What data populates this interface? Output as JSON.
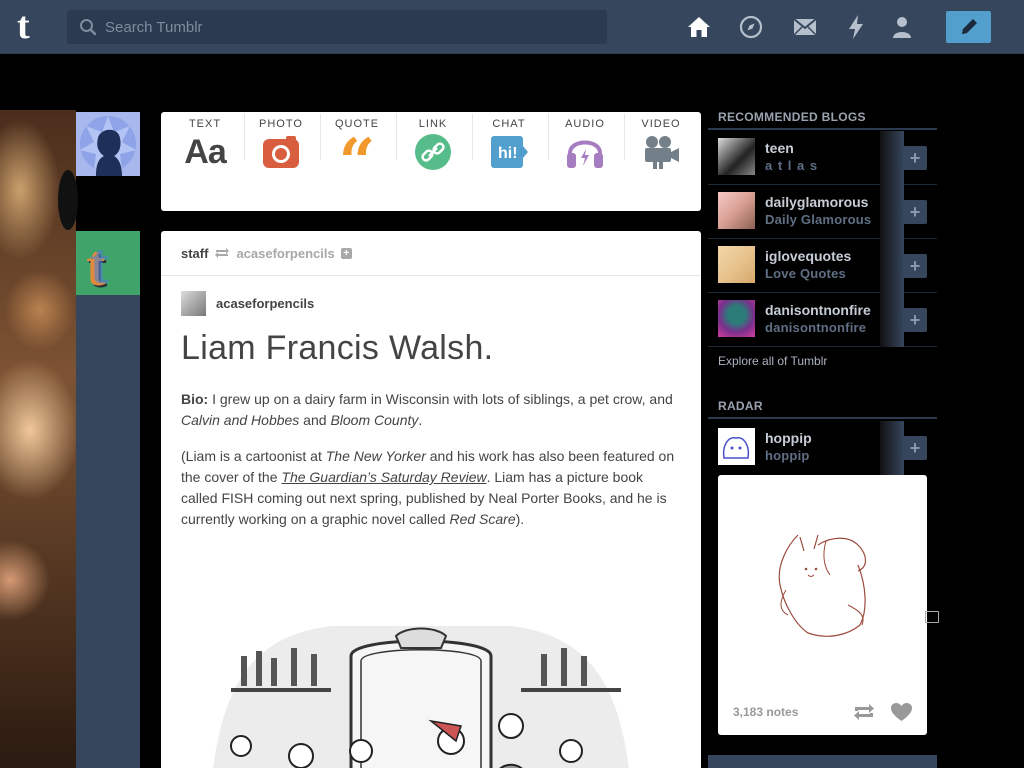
{
  "header": {
    "search_placeholder": "Search Tumblr",
    "nav_icons": [
      "home-icon",
      "explore-icon",
      "inbox-icon",
      "activity-icon",
      "account-icon"
    ],
    "compose_icon": "pencil-icon",
    "colors": {
      "header_bg": "#36465d",
      "accent": "#529ecc"
    }
  },
  "post_types": [
    {
      "label": "TEXT",
      "icon": "text-icon",
      "color": "#444444"
    },
    {
      "label": "PHOTO",
      "icon": "camera-icon",
      "color": "#d95e40"
    },
    {
      "label": "QUOTE",
      "icon": "quote-icon",
      "color": "#f2992e"
    },
    {
      "label": "LINK",
      "icon": "link-icon",
      "color": "#56bc8a"
    },
    {
      "label": "CHAT",
      "icon": "chat-icon",
      "color": "#529ecc"
    },
    {
      "label": "AUDIO",
      "icon": "headphones-icon",
      "color": "#a77dc2"
    },
    {
      "label": "VIDEO",
      "icon": "video-camera-icon",
      "color": "#748089"
    }
  ],
  "post": {
    "reblogger": "staff",
    "source": "acaseforpencils",
    "author": "acaseforpencils",
    "title": "Liam Francis Walsh.",
    "bio_label": "Bio:",
    "bio_text": " I grew up on a dairy farm in Wisconsin with lots of siblings, a pet crow, and ",
    "bio_italic1": "Calvin and Hobbes",
    "bio_and": " and ",
    "bio_italic2": "Bloom County",
    "bio_end": ".",
    "p2_a": "(Liam is a cartoonist at ",
    "p2_i1": "The New Yorker",
    "p2_b": " and his work has also been featured on the cover of the ",
    "p2_link": "The Guardian’s Saturday Review",
    "p2_c": ". Liam has a picture book called FISH coming out next spring, published by Neal Porter Books, and he is currently working on a graphic novel called ",
    "p2_i2": "Red Scare",
    "p2_d": ")."
  },
  "sidebar": {
    "recommended_heading": "RECOMMENDED BLOGS",
    "blogs": [
      {
        "name": "teen",
        "title": "a t l a s"
      },
      {
        "name": "dailyglamorous",
        "title": "Daily Glamorous"
      },
      {
        "name": "iglovequotes",
        "title": "Love Quotes"
      },
      {
        "name": "danisontnonfire",
        "title": "danisontnonfire"
      }
    ],
    "explore_link": "Explore all of Tumblr",
    "radar_heading": "RADAR",
    "radar": {
      "name": "hoppip",
      "title": "hoppip",
      "notes": "3,183 notes"
    },
    "follow_label": "+"
  }
}
